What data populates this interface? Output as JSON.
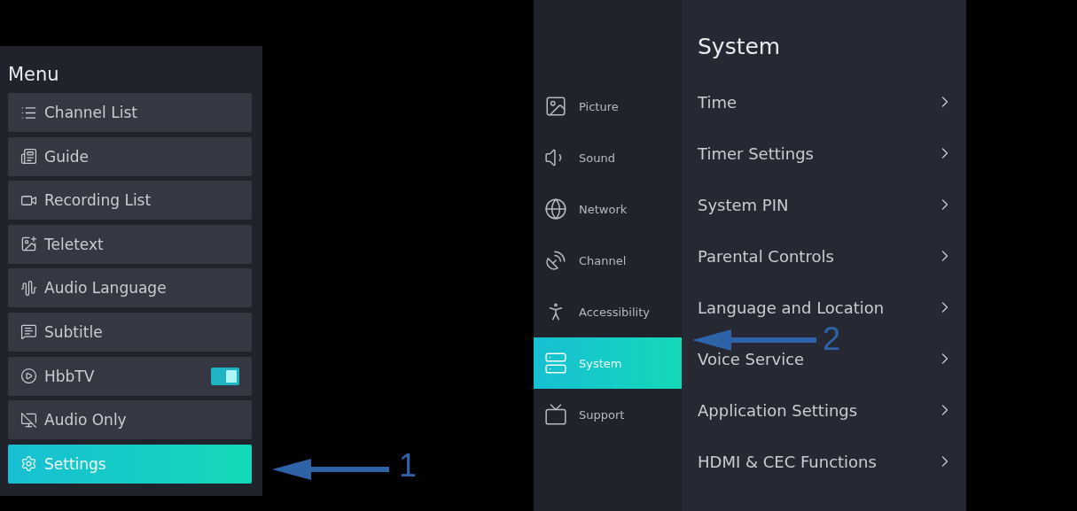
{
  "menu": {
    "title": "Menu",
    "items": [
      {
        "label": "Channel List",
        "kind": "plain",
        "selected": false
      },
      {
        "label": "Guide",
        "kind": "plain",
        "selected": false
      },
      {
        "label": "Recording List",
        "kind": "plain",
        "selected": false
      },
      {
        "label": "Teletext",
        "kind": "plain",
        "selected": false
      },
      {
        "label": "Audio Language",
        "kind": "plain",
        "selected": false
      },
      {
        "label": "Subtitle",
        "kind": "plain",
        "selected": false
      },
      {
        "label": "HbbTV",
        "kind": "toggle",
        "on": true,
        "selected": false
      },
      {
        "label": "Audio Only",
        "kind": "plain",
        "selected": false
      },
      {
        "label": "Settings",
        "kind": "plain",
        "selected": true
      }
    ]
  },
  "settings": {
    "categories": [
      {
        "label": "Picture",
        "selected": false
      },
      {
        "label": "Sound",
        "selected": false
      },
      {
        "label": "Network",
        "selected": false
      },
      {
        "label": "Channel",
        "selected": false
      },
      {
        "label": "Accessibility",
        "selected": false
      },
      {
        "label": "System",
        "selected": true
      },
      {
        "label": "Support",
        "selected": false
      }
    ],
    "title": "System",
    "items": [
      "Time",
      "Timer Settings",
      "System PIN",
      "Parental Controls",
      "Language and Location",
      "Voice Service",
      "Application Settings",
      "HDMI & CEC Functions"
    ]
  },
  "annotations": [
    {
      "label": "1"
    },
    {
      "label": "2"
    }
  ]
}
